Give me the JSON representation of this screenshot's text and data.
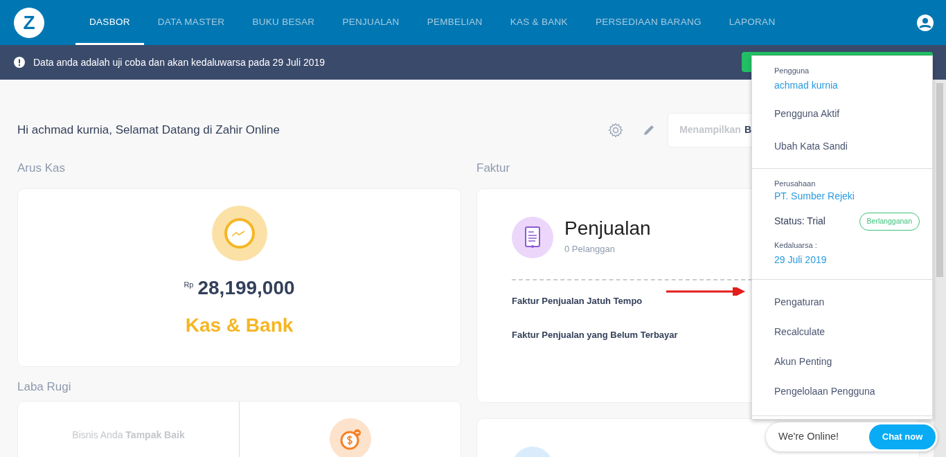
{
  "navbar": {
    "logo": "Z",
    "tabs": [
      {
        "label": "DASBOR",
        "selected": true
      },
      {
        "label": "DATA MASTER",
        "selected": false
      },
      {
        "label": "BUKU BESAR",
        "selected": false
      },
      {
        "label": "PENJUALAN",
        "selected": false
      },
      {
        "label": "PEMBELIAN",
        "selected": false
      },
      {
        "label": "KAS & BANK",
        "selected": false
      },
      {
        "label": "PERSEDIAAN BARANG",
        "selected": false
      },
      {
        "label": "LAPORAN",
        "selected": false
      }
    ]
  },
  "alert": {
    "text": "Data anda adalah uji coba dan akan kedaluwarsa pada 29 Juli 2019"
  },
  "welcome": {
    "title": "Hi achmad kurnia, Selamat Datang di Zahir Online",
    "display_label": "Menampilkan",
    "display_value": "B"
  },
  "cash_flow": {
    "heading": "Arus Kas",
    "currency": "Rp",
    "amount": "28,199,000",
    "title": "Kas & Bank"
  },
  "profit_loss": {
    "heading": "Laba Rugi",
    "message": "Bisnis Anda **Tampak Baik**"
  },
  "invoices": {
    "heading": "Faktur",
    "cards": [
      {
        "title": "Penjualan",
        "subtitle": "0 Pelanggan",
        "links": [
          "Faktur Penjualan Jatuh Tempo",
          "Faktur Penjualan yang Belum Terbayar"
        ]
      }
    ]
  },
  "account_menu": {
    "user_label": "Pengguna",
    "user_name": "achmad kurnia",
    "user_items": [
      "Pengguna Aktif",
      "Ubah Kata Sandi"
    ],
    "company_label": "Perusahaan",
    "company_name": "PT. Sumber Rejeki",
    "status": "Status: Trial",
    "subscribe_button": "Berlangganan",
    "expiry_label": "Kedaluarsa :",
    "expiry_date": "29 Juli 2019",
    "items": [
      "Pengaturan",
      "Recalculate",
      "Akun Penting",
      "Pengelolaan Pengguna"
    ]
  },
  "chat": {
    "status": "We're Online!",
    "button": "Chat now"
  }
}
